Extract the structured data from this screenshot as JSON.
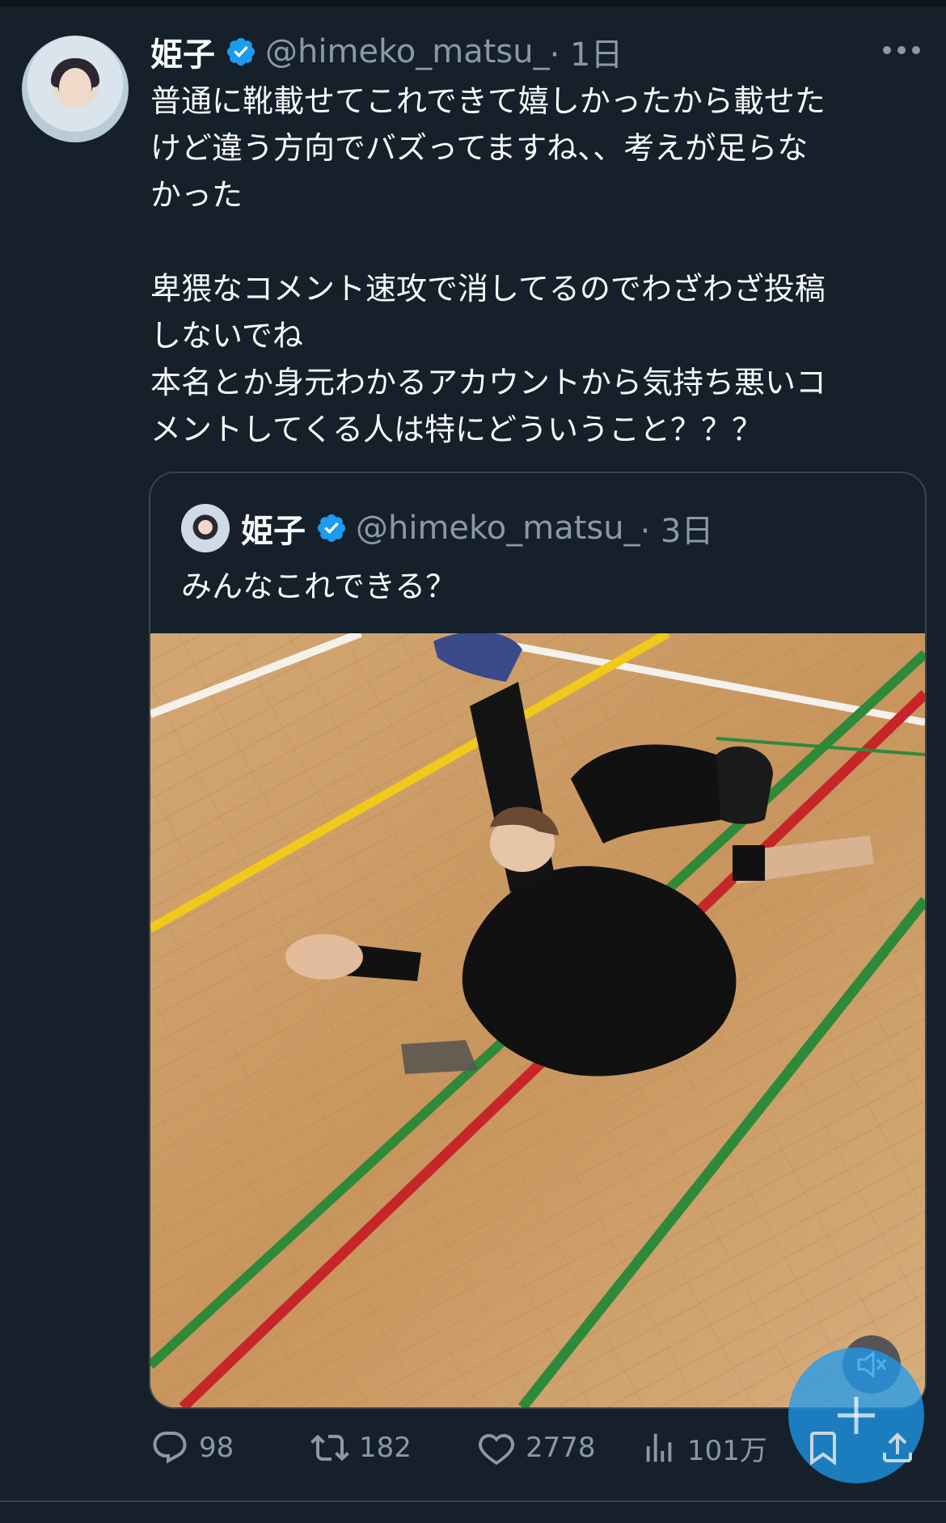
{
  "colors": {
    "background": "#15202b",
    "text": "#f7f9f9",
    "muted": "#8b98a5",
    "accent": "#1d9bf0",
    "border": "#38444d"
  },
  "tweet": {
    "author_name": "姫子",
    "verified_icon": "verified-badge-icon",
    "handle": "@himeko_matsu_",
    "time": "· 1日",
    "more_icon": "more-icon",
    "text_lines": [
      "普通に靴載せてこれできて嬉しかったから載せた",
      "けど違う方向でバズってますね、、考えが足らな",
      "かった",
      "",
      "卑猥なコメント速攻で消してるのでわざわざ投稿",
      "しないでね",
      "本名とか身元わかるアカウントから気持ち悪いコ",
      "メントしてくる人は特にどういうこと？？？"
    ]
  },
  "quoted_tweet": {
    "author_name": "姫子",
    "handle": "@himeko_matsu_",
    "time": "· 3日",
    "text": "みんなこれできる？",
    "media": "video-thumbnail"
  },
  "actions": {
    "reply": {
      "icon": "reply-icon",
      "count": "98"
    },
    "retweet": {
      "icon": "retweet-icon",
      "count": "182"
    },
    "like": {
      "icon": "like-icon",
      "count": "2778"
    },
    "views": {
      "icon": "views-icon",
      "count": "101万"
    },
    "bookmark": {
      "icon": "bookmark-icon"
    },
    "share": {
      "icon": "share-icon"
    }
  },
  "floating": {
    "mute_icon": "mute-icon",
    "compose_icon": "plus-icon"
  }
}
